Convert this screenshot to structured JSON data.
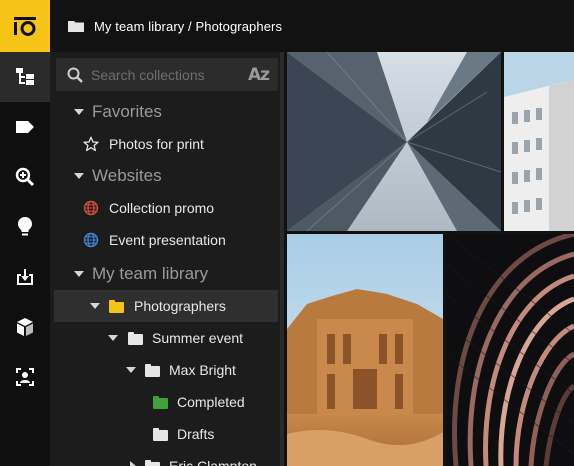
{
  "header": {
    "breadcrumb": "My team library / Photographers"
  },
  "rail": {
    "items": [
      "collections-tree-icon",
      "tag-icon",
      "zoom-search-icon",
      "lightbulb-icon",
      "download-icon",
      "cube-icon",
      "person-frame-icon"
    ]
  },
  "search": {
    "placeholder": "Search collections",
    "sort_label": "Az"
  },
  "sidebar": {
    "favorites": {
      "label": "Favorites",
      "items": [
        "Photos for print"
      ]
    },
    "websites": {
      "label": "Websites",
      "items": [
        "Collection promo",
        "Event presentation"
      ]
    },
    "library": {
      "label": "My team library",
      "photographers": "Photographers",
      "summer_event": "Summer event",
      "max_bright": "Max Bright",
      "completed": "Completed",
      "drafts": "Drafts",
      "eric": "Eric Clampton"
    }
  },
  "colors": {
    "accent": "#f6c416",
    "completed_folder": "#3fa33a",
    "folder_yellow": "#f6c416"
  }
}
